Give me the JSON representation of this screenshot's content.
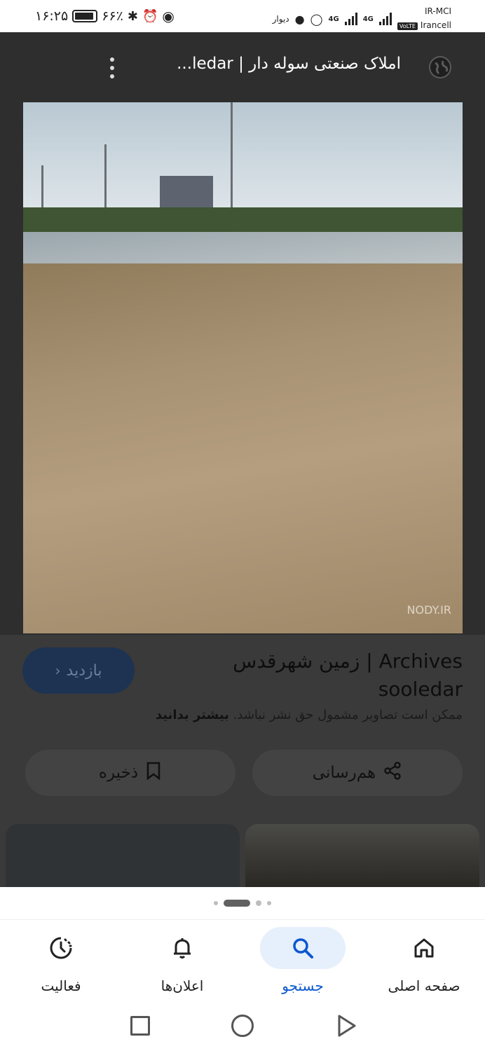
{
  "status_bar": {
    "time": "۱۶:۲۵",
    "battery": "۶۶٪",
    "app_label": "دیوار",
    "network_type": "4G",
    "carrier_1": "IR-MCI",
    "carrier_2": "Irancell",
    "volte": "VoLTE"
  },
  "app_bar": {
    "title": "املاک صنعتی سوله دار | ledar..."
  },
  "image": {
    "watermark": "NODY.IR"
  },
  "info": {
    "title_line1": "زمین شهرقدس | Archives",
    "title_line2": "sooledar",
    "visit_label": "بازدید",
    "notice_text": "ممکن است تصاویر مشمول حق نشر نباشد.",
    "notice_link": "بیشتر بدانید",
    "share_label": "هم‌رسانی",
    "save_label": "ذخیره"
  },
  "carousel": {
    "dot_count": 4,
    "active_index": 1
  },
  "bottom_nav": {
    "items": [
      {
        "label": "صفحه اصلی",
        "icon": "home-icon"
      },
      {
        "label": "جستجو",
        "icon": "search-icon",
        "active": true
      },
      {
        "label": "اعلان‌ها",
        "icon": "bell-icon"
      },
      {
        "label": "فعالیت",
        "icon": "activity-icon"
      }
    ]
  },
  "colors": {
    "active_blue": "#0b57d0",
    "active_pill": "#e6effc",
    "dark_bar": "#2e2e2e"
  }
}
